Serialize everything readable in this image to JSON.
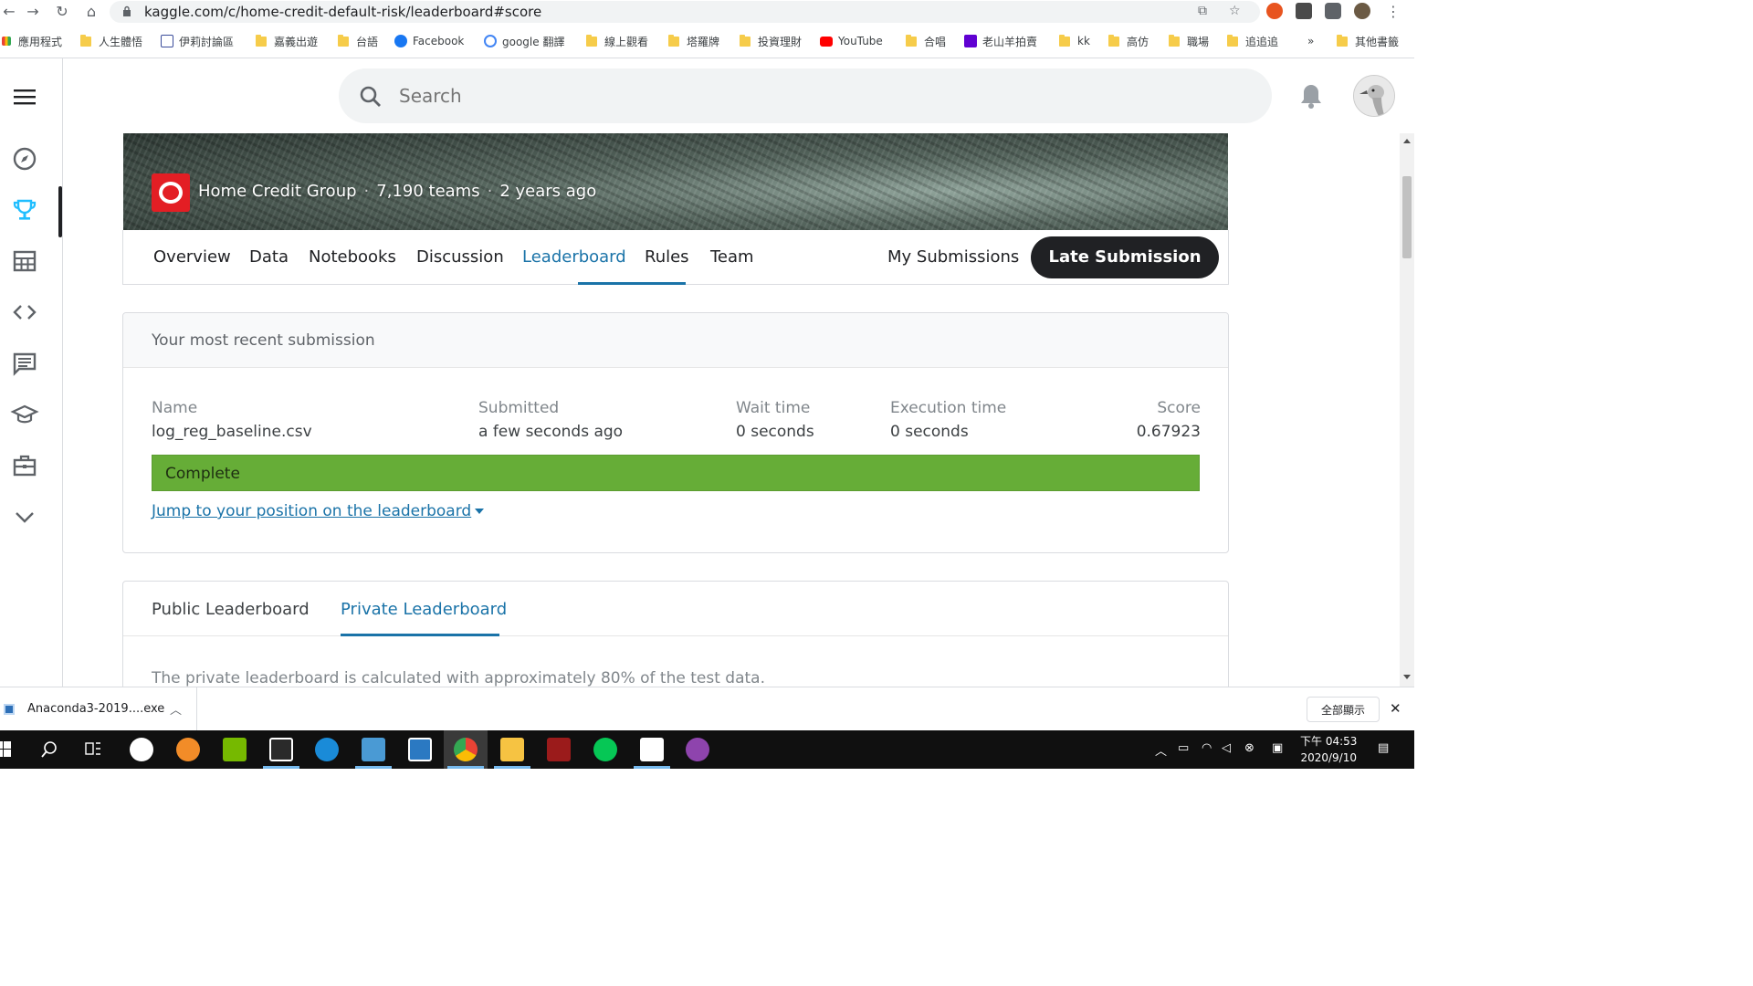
{
  "browser": {
    "url": "kaggle.com/c/home-credit-default-risk/leaderboard#score",
    "bookmarks": [
      {
        "label": "應用程式",
        "icon": "apps-grid-icon"
      },
      {
        "label": "人生體悟",
        "icon": "folder-icon"
      },
      {
        "label": "伊莉討論區",
        "icon": "eyny-icon"
      },
      {
        "label": "嘉義出遊",
        "icon": "folder-icon"
      },
      {
        "label": "台語",
        "icon": "folder-icon"
      },
      {
        "label": "Facebook",
        "icon": "facebook-icon"
      },
      {
        "label": "google 翻譯",
        "icon": "google-icon"
      },
      {
        "label": "線上觀看",
        "icon": "folder-icon"
      },
      {
        "label": "塔羅牌",
        "icon": "folder-icon"
      },
      {
        "label": "投資理財",
        "icon": "folder-icon"
      },
      {
        "label": "YouTube",
        "icon": "youtube-icon"
      },
      {
        "label": "合唱",
        "icon": "folder-icon"
      },
      {
        "label": "老山羊拍賣",
        "icon": "yahoo-icon"
      },
      {
        "label": "kk",
        "icon": "folder-icon"
      },
      {
        "label": "高仿",
        "icon": "folder-icon"
      },
      {
        "label": "職場",
        "icon": "folder-icon"
      },
      {
        "label": "追追追",
        "icon": "folder-icon"
      },
      {
        "label": "»",
        "icon": "overflow-icon"
      },
      {
        "label": "其他書籤",
        "icon": "folder-icon"
      }
    ]
  },
  "kaggle": {
    "search_placeholder": "Search",
    "rail_icons": [
      "menu-icon",
      "compass-icon",
      "trophy-icon",
      "table-icon",
      "code-icon",
      "comment-icon",
      "school-icon",
      "briefcase-icon",
      "chevron-down-icon"
    ]
  },
  "competition": {
    "host": "Home Credit Group",
    "teams": "7,190 teams",
    "age": "2 years ago",
    "tabs": [
      "Overview",
      "Data",
      "Notebooks",
      "Discussion",
      "Leaderboard",
      "Rules",
      "Team"
    ],
    "active_tab": "Leaderboard",
    "my_submissions": "My Submissions",
    "late_submission": "Late Submission"
  },
  "submission": {
    "heading": "Your most recent submission",
    "name_label": "Name",
    "name": "log_reg_baseline.csv",
    "submitted_label": "Submitted",
    "submitted": "a few seconds ago",
    "wait_label": "Wait time",
    "wait": "0 seconds",
    "exec_label": "Execution time",
    "exec": "0 seconds",
    "score_label": "Score",
    "score": "0.67923",
    "status": "Complete",
    "jump_link": "Jump to your position on the leaderboard"
  },
  "leaderboard": {
    "public_tab": "Public Leaderboard",
    "private_tab": "Private Leaderboard",
    "note": "The private leaderboard is calculated with approximately 80% of the test data."
  },
  "downloads": {
    "file": "Anaconda3-2019....exe",
    "show_all": "全部顯示"
  },
  "taskbar": {
    "time": "下午 04:53",
    "date": "2020/9/10"
  },
  "colors": {
    "accent": "#1a73a8",
    "complete": "#66ad37",
    "dark_button": "#202124"
  }
}
